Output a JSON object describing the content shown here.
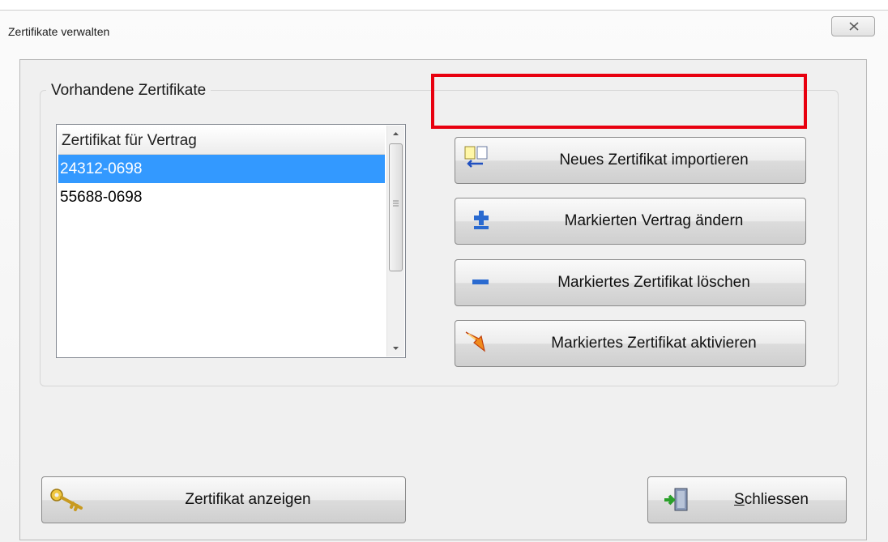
{
  "window": {
    "title": "Zertifikate verwalten"
  },
  "group": {
    "label": "Vorhandene Zertifikate"
  },
  "list": {
    "header": "Zertifikat für Vertrag",
    "rows": [
      "24312-0698",
      "55688-0698"
    ],
    "selected_index": 0
  },
  "buttons": {
    "import": "Neues Zertifikat importieren",
    "edit": "Markierten Vertrag ändern",
    "delete": "Markiertes Zertifikat löschen",
    "activate": "Markiertes Zertifikat aktivieren",
    "show": "Zertifikat anzeigen",
    "close_rest": "chliessen",
    "close_mnemonic": "S"
  },
  "colors": {
    "selection": "#3399ff",
    "highlight": "#e8000f"
  },
  "icons": [
    "close-icon",
    "import-icon",
    "plus-icon",
    "minus-icon",
    "activate-icon",
    "key-icon",
    "exit-icon"
  ]
}
